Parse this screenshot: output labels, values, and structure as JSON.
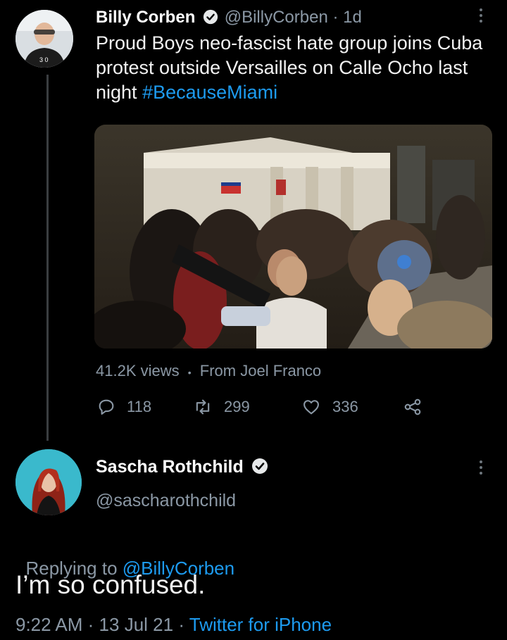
{
  "tweet1": {
    "display_name": "Billy Corben",
    "handle": "@BillyCorben",
    "separator": "·",
    "time": "1d",
    "text_plain": "Proud Boys neo-fascist hate group joins Cuba protest outside Versailles on Calle Ocho last night ",
    "hashtag": "#BecauseMiami",
    "views": "41.2K views",
    "bullet": "•",
    "source": "From Joel Franco",
    "replies": "118",
    "retweets": "299",
    "likes": "336"
  },
  "tweet2": {
    "display_name": "Sascha Rothchild",
    "handle": "@sascharothchild",
    "replying_prefix": "Replying to ",
    "replying_to": "@BillyCorben",
    "text": "I’m so confused.",
    "time": "9:22 AM",
    "sep1": "·",
    "date": "13 Jul 21",
    "sep2": "·",
    "client": "Twitter for iPhone"
  },
  "icons": [
    "verified-badge-icon",
    "more-options-icon",
    "reply-icon",
    "retweet-icon",
    "like-icon",
    "share-icon"
  ],
  "colors": {
    "background": "#000000",
    "text": "#e7e9ea",
    "muted": "#8b98a5",
    "link": "#1d9bf0"
  }
}
